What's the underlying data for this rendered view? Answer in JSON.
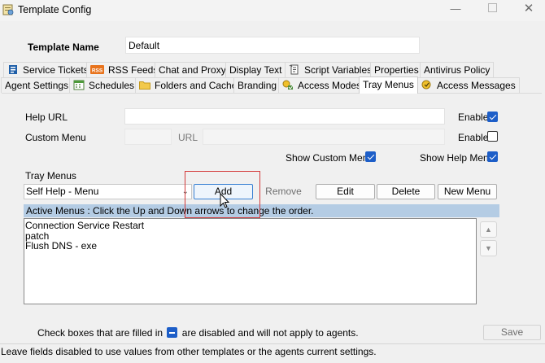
{
  "window": {
    "title": "Template Config",
    "icon": "config-app-icon"
  },
  "template_name": {
    "label": "Template Name",
    "value": "Default"
  },
  "tabs_row1": [
    {
      "label": "Service Tickets",
      "icon": "ticket-icon"
    },
    {
      "label": "RSS Feeds",
      "icon": "rss-icon"
    },
    {
      "label": "Chat and Proxy",
      "icon": ""
    },
    {
      "label": "Display Text",
      "icon": ""
    },
    {
      "label": "Script Variables",
      "icon": "script-icon"
    },
    {
      "label": "Properties",
      "icon": ""
    },
    {
      "label": "Antivirus Policy",
      "icon": ""
    }
  ],
  "tabs_row2": [
    {
      "label": "Agent Settings",
      "icon": ""
    },
    {
      "label": "Schedules",
      "icon": "schedule-icon"
    },
    {
      "label": "Folders and Cache",
      "icon": "folder-icon"
    },
    {
      "label": "Branding",
      "icon": ""
    },
    {
      "label": "Access Modes",
      "icon": "access-icon"
    },
    {
      "label": "Tray Menus",
      "icon": "",
      "active": true
    },
    {
      "label": "Access Messages",
      "icon": "message-icon"
    }
  ],
  "help_url": {
    "label": "Help URL",
    "value": "",
    "enable_label": "Enable",
    "enable_checked": true
  },
  "custom_menu": {
    "label": "Custom Menu",
    "url_label": "URL",
    "enable_label": "Enable",
    "enable_checked": false
  },
  "show_custom_menu": {
    "label": "Show Custom Menu",
    "checked": true
  },
  "show_help_menu": {
    "label": "Show Help Menu",
    "checked": true
  },
  "tray_menus": {
    "label": "Tray Menus",
    "selected": "Self Help - Menu",
    "buttons": {
      "add": "Add",
      "remove": "Remove",
      "edit": "Edit",
      "delete": "Delete",
      "new_menu": "New Menu"
    }
  },
  "active_menus": {
    "banner": "Active Menus : Click the Up and Down arrows to change the order.",
    "items": [
      "Connection Service Restart",
      "patch",
      "Flush DNS - exe"
    ]
  },
  "footer": {
    "note_before": "Check boxes that are filled in",
    "note_after": "are disabled and will not apply to agents.",
    "save": "Save",
    "status": "Leave fields disabled to use values from other templates or the agents current settings."
  },
  "colors": {
    "accent": "#1d5ec8",
    "banner": "#b4cce4",
    "highlight": "#d43a3a"
  }
}
